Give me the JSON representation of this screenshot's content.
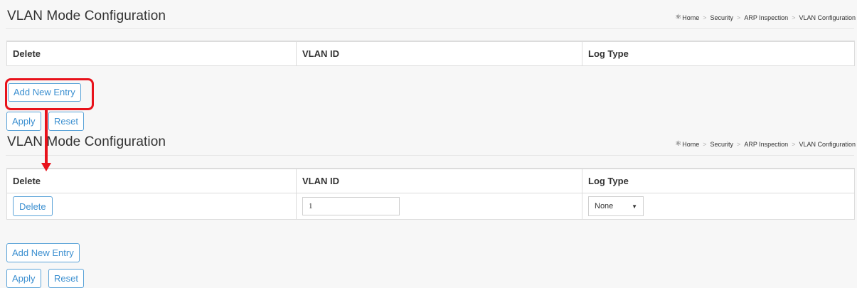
{
  "panels": [
    {
      "title": "VLAN Mode Configuration",
      "breadcrumb": [
        "Home",
        "Security",
        "ARP Inspection",
        "VLAN Configuration"
      ],
      "columns": [
        "Delete",
        "VLAN ID",
        "Log Type"
      ],
      "buttons": {
        "add": "Add New Entry",
        "apply": "Apply",
        "reset": "Reset"
      }
    },
    {
      "title": "VLAN Mode Configuration",
      "breadcrumb": [
        "Home",
        "Security",
        "ARP Inspection",
        "VLAN Configuration"
      ],
      "columns": [
        "Delete",
        "VLAN ID",
        "Log Type"
      ],
      "rows": [
        {
          "delete_label": "Delete",
          "vlan_id": "1",
          "log_type": "None"
        }
      ],
      "buttons": {
        "add": "Add New Entry",
        "apply": "Apply",
        "reset": "Reset"
      }
    }
  ],
  "annotation": {
    "color": "#e8121b"
  },
  "colors": {
    "accent": "#3b8fd0",
    "background": "#f7f7f7"
  }
}
